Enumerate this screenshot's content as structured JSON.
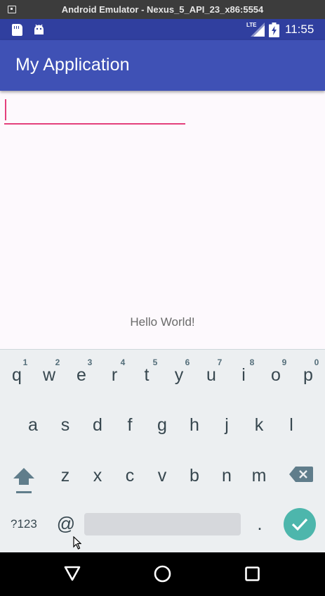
{
  "window": {
    "title": "Android Emulator - Nexus_5_API_23_x86:5554",
    "icon": "emulator-window-icon"
  },
  "status_bar": {
    "background": "#303f9f",
    "icons": [
      "sd-card-icon",
      "android-debug-icon",
      "lte-signal-icon",
      "battery-charging-icon"
    ],
    "network": "LTE",
    "time": "11:55"
  },
  "app_bar": {
    "title": "My Application",
    "color": "#3f51b5"
  },
  "content": {
    "edit_text": {
      "value": "",
      "underline_color": "#e4407c"
    },
    "hello_text": "Hello World!"
  },
  "keyboard": {
    "row1": [
      {
        "key": "q",
        "hint": "1"
      },
      {
        "key": "w",
        "hint": "2"
      },
      {
        "key": "e",
        "hint": "3"
      },
      {
        "key": "r",
        "hint": "4"
      },
      {
        "key": "t",
        "hint": "5"
      },
      {
        "key": "y",
        "hint": "6"
      },
      {
        "key": "u",
        "hint": "7"
      },
      {
        "key": "i",
        "hint": "8"
      },
      {
        "key": "o",
        "hint": "9"
      },
      {
        "key": "p",
        "hint": "0"
      }
    ],
    "row2": [
      "a",
      "s",
      "d",
      "f",
      "g",
      "h",
      "j",
      "k",
      "l"
    ],
    "row3": [
      "z",
      "x",
      "c",
      "v",
      "b",
      "n",
      "m"
    ],
    "symbols_label": "?123",
    "at_label": "@",
    "period_label": ".",
    "enter_color": "#4db6ac"
  },
  "nav_bar": {
    "icons": [
      "back-icon",
      "home-icon",
      "recents-icon"
    ]
  }
}
